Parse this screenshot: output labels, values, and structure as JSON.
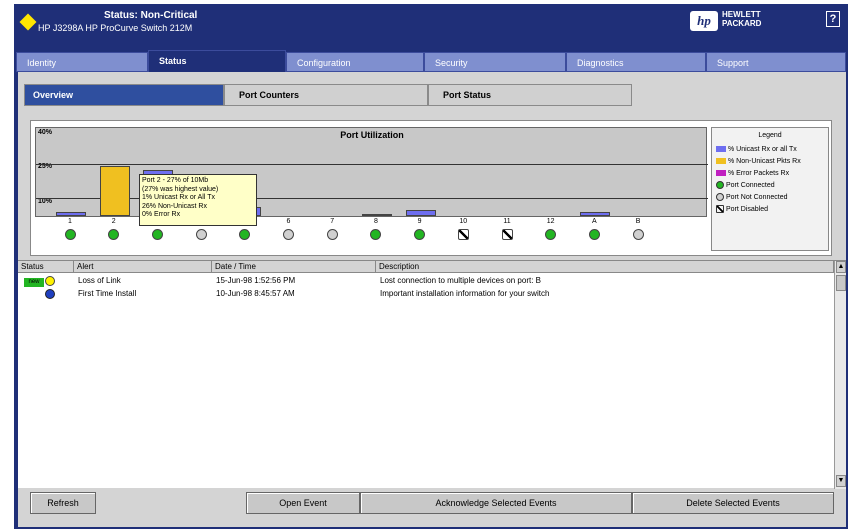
{
  "header": {
    "status_title": "Status: Non-Critical",
    "device_name": "HP J3298A HP ProCurve Switch 212M",
    "hp_logo": "hp",
    "hp_text_line1": "HEWLETT",
    "hp_text_line2": "PACKARD",
    "help_label": "?"
  },
  "tabs": [
    {
      "label": "Identity"
    },
    {
      "label": "Status"
    },
    {
      "label": "Configuration"
    },
    {
      "label": "Security"
    },
    {
      "label": "Diagnostics"
    },
    {
      "label": "Support"
    }
  ],
  "subtabs": [
    {
      "label": "Overview"
    },
    {
      "label": "Port Counters"
    },
    {
      "label": "Port Status"
    }
  ],
  "chart_data": {
    "type": "bar",
    "title": "Port Utilization",
    "ylabels": [
      "40%",
      "25%",
      "10%"
    ],
    "categories": [
      "1",
      "2",
      "3",
      "4",
      "5",
      "6",
      "7",
      "8",
      "9",
      "10",
      "11",
      "12",
      "A",
      "B"
    ],
    "series": [
      {
        "name": "% Unicast Rx or all Tx",
        "color": "#6e6ef0",
        "values": [
          2,
          0,
          25,
          0,
          5,
          0,
          0,
          1,
          3,
          0,
          0,
          0,
          2,
          0
        ]
      },
      {
        "name": "% Non-Unicast Pkts Rx",
        "color": "#f0c020",
        "values": [
          0,
          27,
          0,
          0,
          0,
          0,
          0,
          0,
          0,
          0,
          0,
          0,
          0,
          0
        ]
      },
      {
        "name": "% Error Packets Rx",
        "color": "#c020c0",
        "values": [
          0,
          0,
          0,
          0,
          0,
          0,
          0,
          0,
          0,
          0,
          0,
          0,
          0,
          0
        ]
      }
    ],
    "ylim": [
      0,
      40
    ]
  },
  "ports": [
    {
      "label": "1",
      "state": "connected"
    },
    {
      "label": "2",
      "state": "connected"
    },
    {
      "label": "3",
      "state": "connected"
    },
    {
      "label": "4",
      "state": "not-connected"
    },
    {
      "label": "5",
      "state": "connected"
    },
    {
      "label": "6",
      "state": "not-connected"
    },
    {
      "label": "7",
      "state": "not-connected"
    },
    {
      "label": "8",
      "state": "connected"
    },
    {
      "label": "9",
      "state": "connected"
    },
    {
      "label": "10",
      "state": "disabled"
    },
    {
      "label": "11",
      "state": "disabled"
    },
    {
      "label": "12",
      "state": "connected"
    },
    {
      "label": "A",
      "state": "connected"
    },
    {
      "label": "B",
      "state": "not-connected"
    }
  ],
  "tooltip": {
    "line1": "Port 2 - 27% of 10Mb",
    "line2": "(27% was highest value)",
    "line3": "1% Unicast Rx or All Tx",
    "line4": "26% Non-Unicast Rx",
    "line5": "0% Error Rx"
  },
  "legend": {
    "title": "Legend",
    "items": [
      {
        "label": "% Unicast Rx or all Tx",
        "color": "#6e6ef0",
        "kind": "swatch"
      },
      {
        "label": "% Non-Unicast Pkts Rx",
        "color": "#f0c020",
        "kind": "swatch"
      },
      {
        "label": "% Error Packets Rx",
        "color": "#c020c0",
        "kind": "swatch"
      },
      {
        "label": "Port Connected",
        "color": "#22b522",
        "kind": "dot"
      },
      {
        "label": "Port Not Connected",
        "color": "#d0d0d0",
        "kind": "dot"
      },
      {
        "label": "Port Disabled",
        "color": "#ffffff",
        "kind": "disabled"
      }
    ]
  },
  "alerts": {
    "columns": [
      "Status",
      "Alert",
      "Date / Time",
      "Description"
    ],
    "rows": [
      {
        "status_badge": "new",
        "status_icon": "yellow-circle",
        "alert": "Loss of Link",
        "datetime": "15-Jun-98 1:52:56 PM",
        "description": "Lost connection to multiple devices on port: B"
      },
      {
        "status_badge": "",
        "status_icon": "blue-info",
        "alert": "First Time Install",
        "datetime": "10-Jun-98 8:45:57 AM",
        "description": "Important installation information for your switch"
      }
    ]
  },
  "buttons": {
    "refresh": "Refresh",
    "open_event": "Open Event",
    "acknowledge": "Acknowledge Selected Events",
    "delete": "Delete Selected Events"
  },
  "colors": {
    "frame": "#1f2f78",
    "port_connected": "#22b522",
    "port_not_connected": "#d0d0d0"
  }
}
